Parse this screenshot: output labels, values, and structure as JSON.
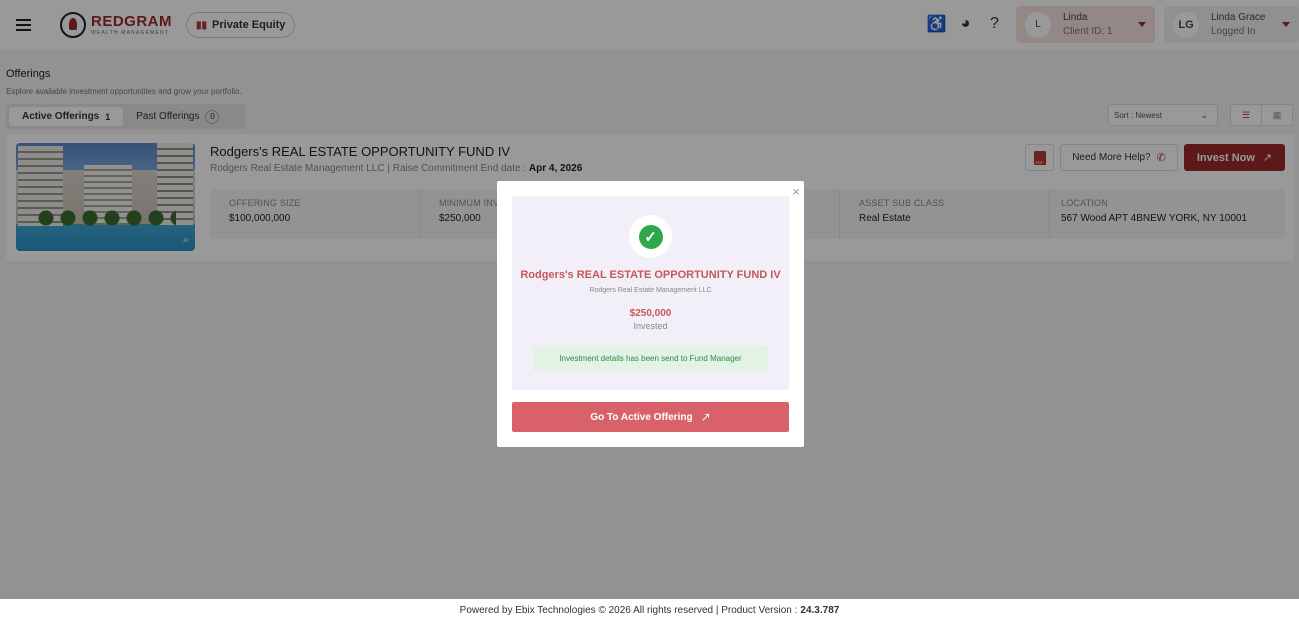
{
  "header": {
    "brand_name": "REDGRAM",
    "brand_tagline": "WEALTH MANAGEMENT",
    "product_badge": "Private Equity",
    "client": {
      "avatar": "L",
      "name": "Linda",
      "sub": "Client ID: 1"
    },
    "user": {
      "avatar": "LG",
      "name": "Linda Grace",
      "sub": "Logged In"
    }
  },
  "page": {
    "title": "Offerings",
    "subtitle": "Explore available investment opportunities and grow your portfolio.",
    "tabs": [
      {
        "label": "Active Offerings",
        "count": "1"
      },
      {
        "label": "Past Offerings",
        "count": "0"
      }
    ],
    "sort_label": "Sort : Newest"
  },
  "offering": {
    "title": "Rodgers's REAL ESTATE OPPORTUNITY FUND IV",
    "manager": "Rodgers Real Estate Management LLC",
    "end_date_label": "Raise Commitment End date :",
    "end_date": "Apr 4, 2026",
    "help_label": "Need More Help?",
    "invest_label": "Invest Now",
    "pdf_label": "PDF",
    "stats": [
      {
        "label": "OFFERING SIZE",
        "value": "$100,000,000"
      },
      {
        "label": "MINIMUM INV",
        "value": "$250,000"
      },
      {
        "label": "",
        "value": ""
      },
      {
        "label": "ASSET SUB CLASS",
        "value": "Real Estate"
      },
      {
        "label": "LOCATION",
        "value": "567 Wood APT 4BNEW YORK, NY 10001"
      }
    ]
  },
  "modal": {
    "title": "Rodgers's REAL ESTATE OPPORTUNITY FUND IV",
    "manager": "Rodgers Real Estate Management LLC",
    "amount": "$250,000",
    "amount_label": "Invested",
    "note": "Investment details has been send to Fund Manager",
    "button": "Go To Active Offering"
  },
  "footer": {
    "text": "Powered by Ebix Technologies © 2026 All rights reserved | Product Version :",
    "version": "24.3.787"
  },
  "colors": {
    "brand": "#9c2b2b",
    "success": "#2ea84a",
    "modal_button": "#d9626a"
  }
}
